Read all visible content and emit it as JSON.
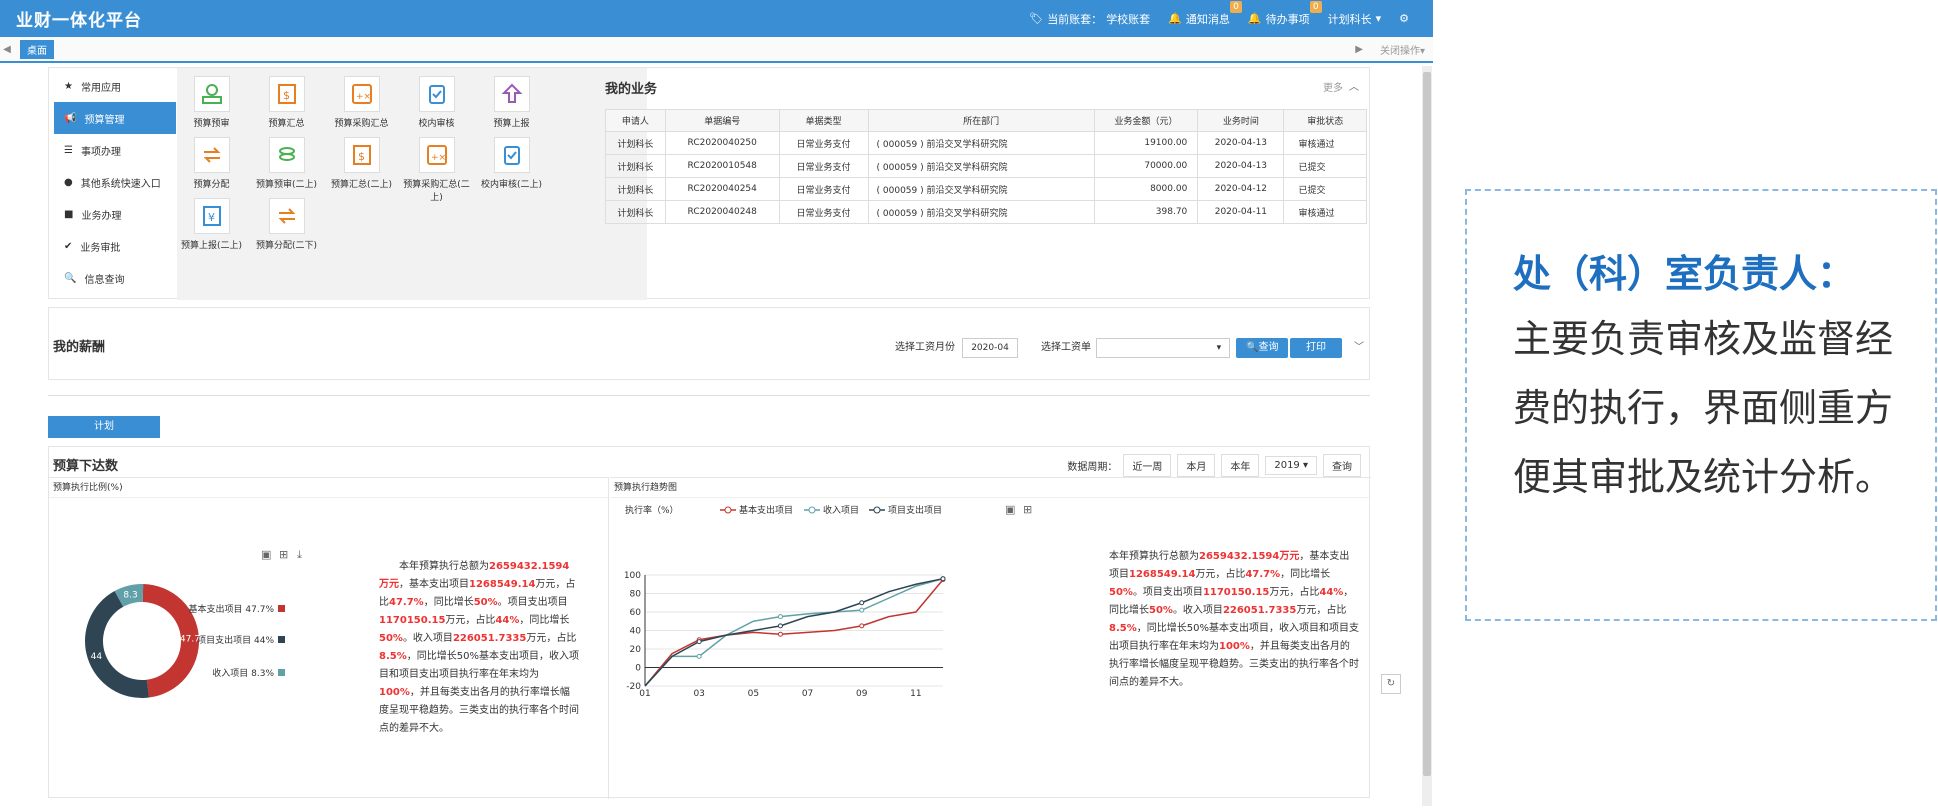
{
  "app": {
    "title": "业财一体化平台",
    "account_label": "当前账套：",
    "account": "学校账套",
    "notify": "通知消息",
    "notify_count": "0",
    "todo": "待办事项",
    "todo_count": "0",
    "user": "计划科长"
  },
  "tabs": {
    "desk": "桌面",
    "close": "关闭操作"
  },
  "nav": [
    "常用应用",
    "预算管理",
    "事项办理",
    "其他系统快速入口",
    "业务办理",
    "业务审批",
    "信息查询"
  ],
  "icons": [
    "预算预审",
    "预算汇总",
    "预算采购汇总",
    "校内审核",
    "预算上报",
    "预算分配",
    "预算预审(二上)",
    "预算汇总(二上)",
    "预算采购汇总(二上)",
    "校内审核(二上)",
    "预算上报(二上)",
    "预算分配(二下)"
  ],
  "mybiz": {
    "title": "我的业务",
    "more": "更多",
    "headers": [
      "申请人",
      "单据编号",
      "单据类型",
      "所在部门",
      "业务金额（元）",
      "业务时间",
      "审批状态"
    ],
    "rows": [
      [
        "计划科长",
        "RC2020040250",
        "日常业务支付",
        "( 000059 ) 前沿交叉学科研究院",
        "19100.00",
        "2020-04-13",
        "审核通过"
      ],
      [
        "计划科长",
        "RC2020010548",
        "日常业务支付",
        "( 000059 ) 前沿交叉学科研究院",
        "70000.00",
        "2020-04-13",
        "已提交"
      ],
      [
        "计划科长",
        "RC2020040254",
        "日常业务支付",
        "( 000059 ) 前沿交叉学科研究院",
        "8000.00",
        "2020-04-12",
        "已提交"
      ],
      [
        "计划科长",
        "RC2020040248",
        "日常业务支付",
        "( 000059 ) 前沿交叉学科研究院",
        "398.70",
        "2020-04-11",
        "审核通过"
      ]
    ]
  },
  "salary": {
    "title": "我的薪酬",
    "month_label": "选择工资月份",
    "month": "2020-04",
    "sheet_label": "选择工资单",
    "query": "查询",
    "print": "打印"
  },
  "plan": {
    "tab": "计划"
  },
  "budget": {
    "title": "预算下达数",
    "period_label": "数据周期：",
    "week": "近一周",
    "month": "本月",
    "year": "本年",
    "year_sel": "2019",
    "query": "查询",
    "left_title": "预算执行比例(%)",
    "right_title": "预算执行趋势图"
  },
  "texts": {
    "l1": "本年预算执行总额为",
    "v1": "2659432.1594万元",
    "l2": "，基本支出项目",
    "v2": "1268549.14",
    "l3": "万元，占比",
    "v3": "47.7%",
    "l4": "，同比增长",
    "v4": "50%",
    "l5": "。项目支出项目",
    "v5": "1170150.15",
    "l6": "万元，占比",
    "v6": "44%",
    "l7": "，同比增长",
    "v7": "50%",
    "l8": "。收入项目",
    "v8": "226051.7335",
    "l9": "万元，占比",
    "v9": "8.5%",
    "l10": "，同比增长50%基本支出项目，收入项目和项目支出项目执行率在年末均为",
    "v10": "100%",
    "l11": "，并且每类支出各月的执行率增长幅度呈现平稳趋势。三类支出的执行率各个时间点的差异不大。"
  },
  "callout": {
    "title": "处（科）室负责人：",
    "body": "主要负责审核及监督经费的执行，界面侧重方便其审批及统计分析。"
  },
  "chart_data": [
    {
      "type": "pie",
      "title": "预算执行比例(%)",
      "labels": [
        "基本支出项目",
        "项目支出项目",
        "收入项目"
      ],
      "legend": [
        "基本支出项目 47.7%",
        "项目支出项目 44%",
        "收入项目 8.3%"
      ],
      "values": [
        47.7,
        44,
        8.3
      ],
      "colors": [
        "#c23531",
        "#2f4554",
        "#61a0a8"
      ]
    },
    {
      "type": "line",
      "title": "预算执行趋势图",
      "ylabel": "执行率（%）",
      "x": [
        "01",
        "02",
        "03",
        "04",
        "05",
        "06",
        "07",
        "08",
        "09",
        "10",
        "11",
        "12"
      ],
      "xticks": [
        "01",
        "03",
        "05",
        "07",
        "09",
        "11"
      ],
      "yticks": [
        -20,
        0,
        20,
        40,
        60,
        80,
        100
      ],
      "ylim": [
        -20,
        100
      ],
      "series": [
        {
          "name": "基本支出项目",
          "color": "#c23531",
          "values": [
            -20,
            15,
            30,
            35,
            38,
            36,
            38,
            40,
            45,
            55,
            60,
            95
          ]
        },
        {
          "name": "收入项目",
          "color": "#61a0a8",
          "values": [
            -20,
            12,
            12,
            35,
            50,
            55,
            58,
            60,
            62,
            75,
            88,
            96
          ]
        },
        {
          "name": "项目支出项目",
          "color": "#2f4554",
          "values": [
            -20,
            12,
            28,
            35,
            40,
            45,
            55,
            60,
            70,
            82,
            90,
            96
          ]
        }
      ]
    }
  ]
}
